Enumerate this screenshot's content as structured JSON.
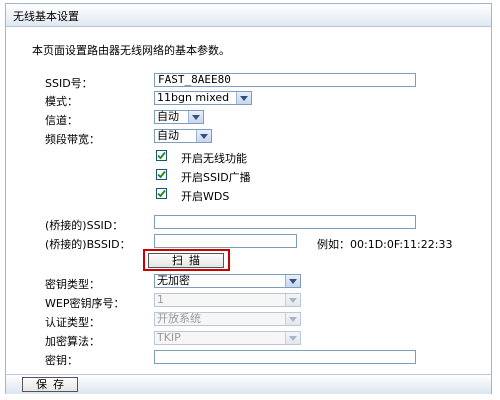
{
  "window": {
    "title": "无线基本设置"
  },
  "intro": "本页面设置路由器无线网络的基本参数。",
  "fields": {
    "ssid": {
      "label": "SSID号：",
      "value": "FAST_8AEE80"
    },
    "mode": {
      "label": "模式：",
      "value": "11bgn mixed"
    },
    "channel": {
      "label": "信道：",
      "value": "自动"
    },
    "bandwidth": {
      "label": "频段带宽：",
      "value": "自动"
    }
  },
  "checkboxes": {
    "wireless": {
      "label": "开启无线功能",
      "checked": true
    },
    "ssid_broadcast": {
      "label": "开启SSID广播",
      "checked": true
    },
    "wds": {
      "label": "开启WDS",
      "checked": true
    }
  },
  "wds": {
    "bridge_ssid": {
      "label": "(桥接的)SSID：",
      "value": ""
    },
    "bridge_bssid": {
      "label": "(桥接的)BSSID：",
      "value": ""
    },
    "example": "例如：00:1D:0F:11:22:33",
    "scan_label": "扫描"
  },
  "security": {
    "key_type": {
      "label": "密钥类型：",
      "value": "无加密"
    },
    "wep_index": {
      "label": "WEP密钥序号：",
      "value": "1"
    },
    "auth_type": {
      "label": "认证类型：",
      "value": "开放系统"
    },
    "cipher": {
      "label": "加密算法：",
      "value": "TKIP"
    },
    "key": {
      "label": "密钥：",
      "value": ""
    }
  },
  "footer": {
    "save_label": "保存"
  },
  "colors": {
    "highlight": "#cc0000",
    "check": "#1a8a1a"
  }
}
